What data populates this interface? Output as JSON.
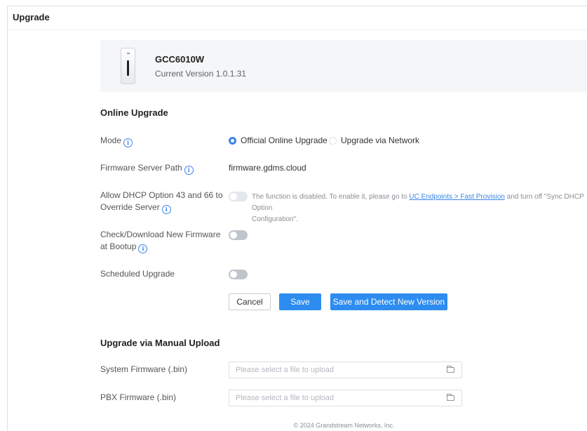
{
  "page": {
    "title": "Upgrade"
  },
  "device": {
    "model": "GCC6010W",
    "current_version": "Current Version 1.0.1.31",
    "image_icon": "device-tower-icon"
  },
  "online_upgrade": {
    "section_title": "Online Upgrade",
    "mode": {
      "label": "Mode",
      "options": [
        {
          "label": "Official Online Upgrade",
          "selected": true
        },
        {
          "label": "Upgrade via Network",
          "selected": false
        }
      ]
    },
    "firmware_server_path": {
      "label": "Firmware Server Path",
      "value": "firmware.gdms.cloud"
    },
    "dhcp_option": {
      "label_line1": "Allow DHCP Option 43 and 66 to",
      "label_line2": "Override Server",
      "enabled": false,
      "disabled": true,
      "note_prefix": "The function is disabled. To enable it, please go to",
      "note_link": "UC Endpoints > Fast Provision",
      "note_middle": "and turn off \"Sync DHCP Option",
      "note_suffix": "Configuration\"."
    },
    "check_at_bootup": {
      "label_line1": "Check/Download New Firmware",
      "label_line2": "at Bootup",
      "enabled": false
    },
    "scheduled_upgrade": {
      "label": "Scheduled Upgrade",
      "enabled": false
    },
    "buttons": {
      "cancel": "Cancel",
      "save": "Save",
      "save_detect": "Save and Detect New Version"
    }
  },
  "manual_upload": {
    "section_title": "Upgrade via Manual Upload",
    "system_firmware": {
      "label": "System Firmware (.bin)",
      "placeholder": "Please select a file to upload"
    },
    "pbx_firmware": {
      "label": "PBX Firmware (.bin)",
      "placeholder": "Please select a file to upload"
    }
  },
  "footer": {
    "copyright": "© 2024 Grandstream Networks, Inc."
  },
  "colors": {
    "accent": "#2d8cf0",
    "info_icon": "#3a84e8",
    "toggle_off": "#c0c4cc",
    "card_background": "#f5f6f8"
  }
}
